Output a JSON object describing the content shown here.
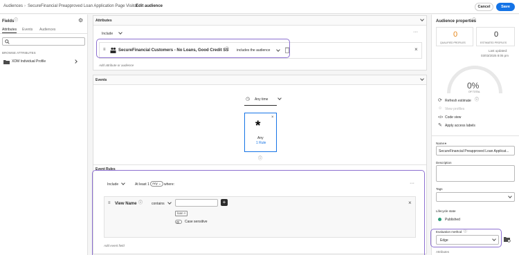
{
  "breadcrumb": {
    "items": [
      "Audiences",
      "SecureFinancial Preapproved Loan Application Page Visitor"
    ],
    "current": "Edit audience"
  },
  "actions": {
    "cancel": "Cancel",
    "save": "Save"
  },
  "left_panel": {
    "title": "Fields",
    "tabs": [
      "Attributes",
      "Events",
      "Audiences"
    ],
    "section_label": "BROWSE ATTRIBUTES",
    "items": [
      {
        "label": "XDM Individual Profile",
        "icon": "folder-icon"
      }
    ]
  },
  "attributes": {
    "title": "Attributes",
    "include": "Include",
    "rule_name": "SecureFinancial Customers - No Loans, Good Credit SS",
    "operator": "includes the audience",
    "add_label": "Add attribute or audience"
  },
  "events": {
    "title": "Events",
    "time": "Any time",
    "card_title": "Any",
    "card_rule": "1 Rule"
  },
  "event_rules": {
    "title": "Event Rules",
    "include": "Include",
    "at_least": "At least 1",
    "any_pill": "Any",
    "where": "where:",
    "field_name": "View Name",
    "operator": "contains",
    "tag": "loan",
    "case_sensitive": "Case sensitive",
    "add_label": "Add event field"
  },
  "properties": {
    "title": "Audience properties",
    "qualified_value": "0",
    "qualified_label": "QUALIFIED PROFILES",
    "estimated_value": "0",
    "estimated_label": "ESTIMATED PROFILES",
    "last_updated_label": "Last updated:",
    "last_updated_value": "03/03/2025 8:05 pm",
    "percent": "0%",
    "percent_label": "OF TOTAL",
    "refresh": "Refresh estimate",
    "view_profiles": "View profiles",
    "code_view": "Code view",
    "apply_labels": "Apply access labels",
    "name_label": "Name",
    "name_value": "SecureFinancial Preapproved Loan Applicat...",
    "description_label": "Description",
    "tags_label": "Tags",
    "lifecycle_label": "Lifecycle state",
    "lifecycle_value": "Published",
    "evaluation_label": "Evaluation method",
    "evaluation_value": "Edge",
    "attributes_label": "Attributes"
  },
  "colors": {
    "accent": "#1473e6",
    "qualified": "#e68619",
    "published": "#2d9d78",
    "highlight": "#8c6fd0"
  }
}
